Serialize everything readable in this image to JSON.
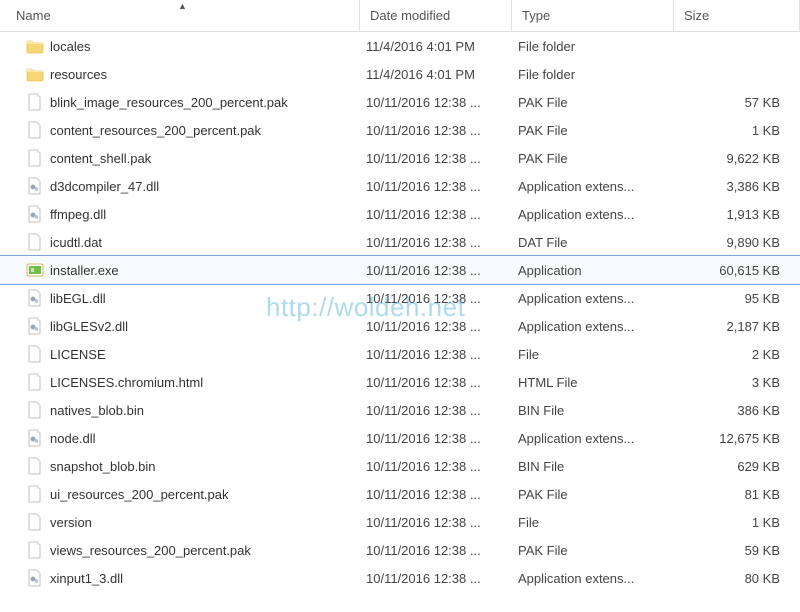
{
  "columns": {
    "name": "Name",
    "date": "Date modified",
    "type": "Type",
    "size": "Size"
  },
  "sort": {
    "column": "name",
    "direction": "asc"
  },
  "watermark": "http://woldeh.net",
  "selected_index": 8,
  "files": [
    {
      "icon": "folder",
      "name": "locales",
      "date": "11/4/2016 4:01 PM",
      "type": "File folder",
      "size": ""
    },
    {
      "icon": "folder",
      "name": "resources",
      "date": "11/4/2016 4:01 PM",
      "type": "File folder",
      "size": ""
    },
    {
      "icon": "file",
      "name": "blink_image_resources_200_percent.pak",
      "date": "10/11/2016 12:38 ...",
      "type": "PAK File",
      "size": "57 KB"
    },
    {
      "icon": "file",
      "name": "content_resources_200_percent.pak",
      "date": "10/11/2016 12:38 ...",
      "type": "PAK File",
      "size": "1 KB"
    },
    {
      "icon": "file",
      "name": "content_shell.pak",
      "date": "10/11/2016 12:38 ...",
      "type": "PAK File",
      "size": "9,622 KB"
    },
    {
      "icon": "dll",
      "name": "d3dcompiler_47.dll",
      "date": "10/11/2016 12:38 ...",
      "type": "Application extens...",
      "size": "3,386 KB"
    },
    {
      "icon": "dll",
      "name": "ffmpeg.dll",
      "date": "10/11/2016 12:38 ...",
      "type": "Application extens...",
      "size": "1,913 KB"
    },
    {
      "icon": "file",
      "name": "icudtl.dat",
      "date": "10/11/2016 12:38 ...",
      "type": "DAT File",
      "size": "9,890 KB"
    },
    {
      "icon": "exe",
      "name": "installer.exe",
      "date": "10/11/2016 12:38 ...",
      "type": "Application",
      "size": "60,615 KB"
    },
    {
      "icon": "dll",
      "name": "libEGL.dll",
      "date": "10/11/2016 12:38 ...",
      "type": "Application extens...",
      "size": "95 KB"
    },
    {
      "icon": "dll",
      "name": "libGLESv2.dll",
      "date": "10/11/2016 12:38 ...",
      "type": "Application extens...",
      "size": "2,187 KB"
    },
    {
      "icon": "file",
      "name": "LICENSE",
      "date": "10/11/2016 12:38 ...",
      "type": "File",
      "size": "2 KB"
    },
    {
      "icon": "file",
      "name": "LICENSES.chromium.html",
      "date": "10/11/2016 12:38 ...",
      "type": "HTML File",
      "size": "3 KB"
    },
    {
      "icon": "file",
      "name": "natives_blob.bin",
      "date": "10/11/2016 12:38 ...",
      "type": "BIN File",
      "size": "386 KB"
    },
    {
      "icon": "dll",
      "name": "node.dll",
      "date": "10/11/2016 12:38 ...",
      "type": "Application extens...",
      "size": "12,675 KB"
    },
    {
      "icon": "file",
      "name": "snapshot_blob.bin",
      "date": "10/11/2016 12:38 ...",
      "type": "BIN File",
      "size": "629 KB"
    },
    {
      "icon": "file",
      "name": "ui_resources_200_percent.pak",
      "date": "10/11/2016 12:38 ...",
      "type": "PAK File",
      "size": "81 KB"
    },
    {
      "icon": "file",
      "name": "version",
      "date": "10/11/2016 12:38 ...",
      "type": "File",
      "size": "1 KB"
    },
    {
      "icon": "file",
      "name": "views_resources_200_percent.pak",
      "date": "10/11/2016 12:38 ...",
      "type": "PAK File",
      "size": "59 KB"
    },
    {
      "icon": "dll",
      "name": "xinput1_3.dll",
      "date": "10/11/2016 12:38 ...",
      "type": "Application extens...",
      "size": "80 KB"
    }
  ]
}
